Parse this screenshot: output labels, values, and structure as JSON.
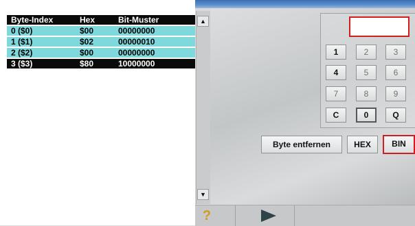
{
  "table": {
    "headers": [
      "Byte-Index",
      "Hex",
      "Bit-Muster"
    ],
    "rows": [
      [
        "0 ($0)",
        "$00",
        "00000000"
      ],
      [
        "1 ($1)",
        "$02",
        "00000010"
      ],
      [
        "2 ($2)",
        "$00",
        "00000000"
      ],
      [
        "3 ($3)",
        "$80",
        "10000000"
      ]
    ],
    "selected_row": 3
  },
  "scrollbar": {
    "up_icon": "up-arrow-icon",
    "down_icon": "down-arrow-icon"
  },
  "keypad": {
    "display_value": "",
    "keys": [
      [
        "1",
        "2",
        "3"
      ],
      [
        "4",
        "5",
        "6"
      ],
      [
        "7",
        "8",
        "9"
      ],
      [
        "C",
        "0",
        "Q"
      ]
    ]
  },
  "buttons": {
    "remove_byte": "Byte entfernen",
    "hex": "HEX",
    "bin": "BIN"
  },
  "bottom_bar": {
    "help_icon": "help-icon",
    "play_icon": "play-icon"
  },
  "colors": {
    "highlight_red": "#d21d20",
    "row_cyan": "#7ed8dc",
    "row_selected": "#0a0a0a"
  }
}
